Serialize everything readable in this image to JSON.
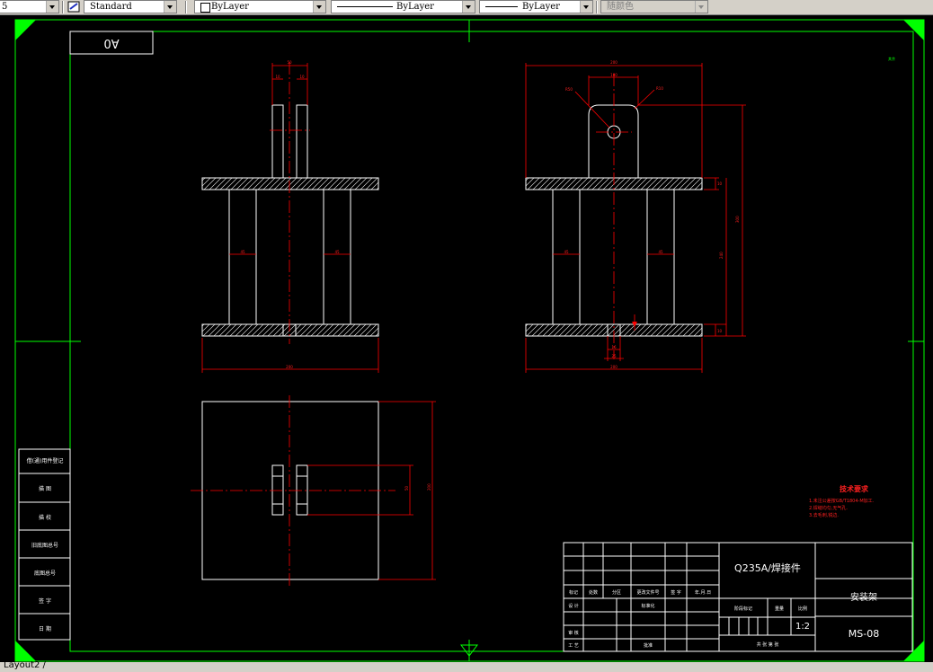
{
  "toolbar": {
    "dimstyle_tail": "5",
    "textstyle": "Standard",
    "layer": "ByLayer",
    "linetype": "ByLayer",
    "lineweight": "ByLayer",
    "plotstyle": "随颜色"
  },
  "tab": {
    "label": "Layout2 /"
  },
  "sheet": {
    "size_label": "A0"
  },
  "views": {
    "front": {
      "dims": [
        "50",
        "10",
        "10",
        "45",
        "45",
        "200"
      ]
    },
    "side": {
      "dims": [
        "200",
        "100",
        "R50",
        "R10",
        "10",
        "300",
        "240",
        "10",
        "45",
        "45",
        "16",
        "25",
        "200"
      ]
    },
    "top": {
      "dims": [
        "50",
        "200"
      ]
    }
  },
  "notes": {
    "title": "技术要求",
    "lines": [
      "1.未注公差按GB/T1804-M加工.",
      "2.焊缝均匀,无气孔.",
      "3.去毛刺,锐边."
    ]
  },
  "left_block": [
    "借(通)用件登记",
    "描 图",
    "描 校",
    "旧底图总号",
    "底图总号",
    "签 字",
    "日 期"
  ],
  "title_block": {
    "material": "Q235A/焊接件",
    "name": "安装架",
    "code": "MS-08",
    "scale": "1:2",
    "row_labels": [
      "标记",
      "处数",
      "分区",
      "更改文件号",
      "签 字",
      "年.月.日"
    ],
    "design_label": "设 计",
    "standard_label": "标准化",
    "stage_label": "阶段标记",
    "weight_label": "重量",
    "ratio_label": "比例",
    "check_label": "审 核",
    "process_label": "工 艺",
    "approve_label": "批准",
    "sheets_label": "共  张  第  张"
  },
  "corner_note": "其余"
}
